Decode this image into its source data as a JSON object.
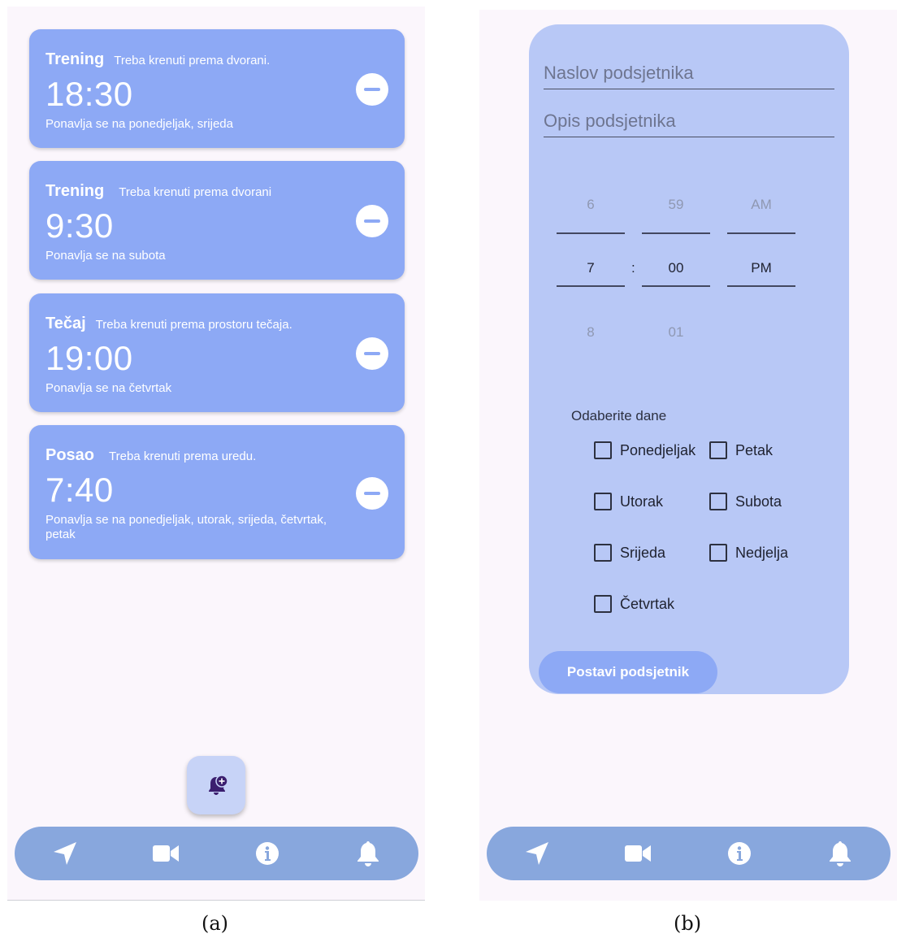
{
  "screen_a": {
    "reminders": [
      {
        "title": "Trening",
        "description": "Treba krenuti prema dvorani.",
        "time": "18:30",
        "repeat": "Ponavlja se na ponedjeljak, srijeda"
      },
      {
        "title": "Trening",
        "description": "Treba krenuti prema dvorani",
        "time": "9:30",
        "repeat": "Ponavlja se na subota"
      },
      {
        "title": "Tečaj",
        "description": "Treba krenuti prema prostoru tečaja.",
        "time": "19:00",
        "repeat": "Ponavlja se na četvrtak"
      },
      {
        "title": "Posao",
        "description": "Treba krenuti prema uredu.",
        "time": "7:40",
        "repeat": "Ponavlja se na ponedjeljak, utorak, srijeda, četvrtak, petak"
      }
    ],
    "remove_icon": "minus-circle-icon",
    "fab_icon": "bell-plus-icon"
  },
  "screen_b": {
    "title_placeholder": "Naslov podsjetnika",
    "description_placeholder": "Opis podsjetnika",
    "time_picker": {
      "hour": {
        "prev": "6",
        "selected": "7",
        "next": "8"
      },
      "minute": {
        "prev": "59",
        "selected": "00",
        "next": "01"
      },
      "separator": ":",
      "ampm": {
        "prev": "AM",
        "selected": "PM"
      }
    },
    "days_label": "Odaberite dane",
    "days": [
      "Ponedjeljak",
      "Petak",
      "Utorak",
      "Subota",
      "Srijeda",
      "Nedjelja",
      "Četvrtak"
    ],
    "submit_label": "Postavi podsjetnik"
  },
  "navbar": {
    "items": [
      "navigation-arrow-icon",
      "video-camera-icon",
      "info-icon",
      "bell-icon"
    ]
  },
  "captions": {
    "a": "(a)",
    "b": "(b)"
  },
  "colors": {
    "card": "#8da9f5",
    "panel": "#b8c8f6",
    "navbar": "#88a7dd",
    "background": "#fbf6fc",
    "fab_icon": "#3b1e6e"
  }
}
